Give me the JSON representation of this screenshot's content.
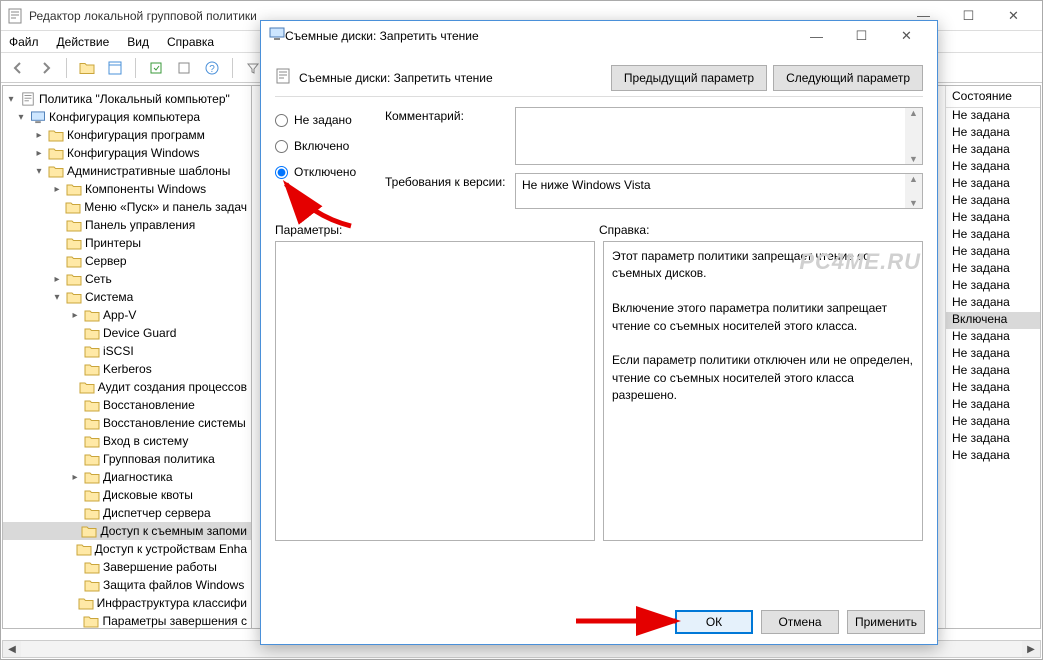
{
  "mainWindow": {
    "title": "Редактор локальной групповой политики",
    "menus": [
      "Файл",
      "Действие",
      "Вид",
      "Справка"
    ],
    "winButtons": {
      "min": "—",
      "max": "☐",
      "close": "✕"
    }
  },
  "tree": {
    "root": "Политика \"Локальный компьютер\"",
    "items": [
      {
        "indent": 0,
        "twist": "▾",
        "icon": "computer",
        "label": "Конфигурация компьютера"
      },
      {
        "indent": 1,
        "twist": "▸",
        "icon": "folder",
        "label": "Конфигурация программ"
      },
      {
        "indent": 1,
        "twist": "▸",
        "icon": "folder",
        "label": "Конфигурация Windows"
      },
      {
        "indent": 1,
        "twist": "▾",
        "icon": "folder",
        "label": "Административные шаблоны"
      },
      {
        "indent": 2,
        "twist": "▸",
        "icon": "folder",
        "label": "Компоненты Windows"
      },
      {
        "indent": 2,
        "twist": "",
        "icon": "folder",
        "label": "Меню «Пуск» и панель задач"
      },
      {
        "indent": 2,
        "twist": "",
        "icon": "folder",
        "label": "Панель управления"
      },
      {
        "indent": 2,
        "twist": "",
        "icon": "folder",
        "label": "Принтеры"
      },
      {
        "indent": 2,
        "twist": "",
        "icon": "folder",
        "label": "Сервер"
      },
      {
        "indent": 2,
        "twist": "▸",
        "icon": "folder",
        "label": "Сеть"
      },
      {
        "indent": 2,
        "twist": "▾",
        "icon": "folder",
        "label": "Система"
      },
      {
        "indent": 3,
        "twist": "▸",
        "icon": "folder",
        "label": "App-V"
      },
      {
        "indent": 3,
        "twist": "",
        "icon": "folder",
        "label": "Device Guard"
      },
      {
        "indent": 3,
        "twist": "",
        "icon": "folder",
        "label": "iSCSI"
      },
      {
        "indent": 3,
        "twist": "",
        "icon": "folder",
        "label": "Kerberos"
      },
      {
        "indent": 3,
        "twist": "",
        "icon": "folder",
        "label": "Аудит создания процессов"
      },
      {
        "indent": 3,
        "twist": "",
        "icon": "folder",
        "label": "Восстановление"
      },
      {
        "indent": 3,
        "twist": "",
        "icon": "folder",
        "label": "Восстановление системы"
      },
      {
        "indent": 3,
        "twist": "",
        "icon": "folder",
        "label": "Вход в систему"
      },
      {
        "indent": 3,
        "twist": "",
        "icon": "folder",
        "label": "Групповая политика"
      },
      {
        "indent": 3,
        "twist": "▸",
        "icon": "folder",
        "label": "Диагностика"
      },
      {
        "indent": 3,
        "twist": "",
        "icon": "folder",
        "label": "Дисковые квоты"
      },
      {
        "indent": 3,
        "twist": "",
        "icon": "folder",
        "label": "Диспетчер сервера"
      },
      {
        "indent": 3,
        "twist": "",
        "icon": "folder",
        "label": "Доступ к съемным запоми",
        "selected": true
      },
      {
        "indent": 3,
        "twist": "",
        "icon": "folder",
        "label": "Доступ к устройствам Enha"
      },
      {
        "indent": 3,
        "twist": "",
        "icon": "folder",
        "label": "Завершение работы"
      },
      {
        "indent": 3,
        "twist": "",
        "icon": "folder",
        "label": "Защита файлов Windows"
      },
      {
        "indent": 3,
        "twist": "",
        "icon": "folder",
        "label": "Инфраструктура классифи"
      },
      {
        "indent": 3,
        "twist": "",
        "icon": "folder",
        "label": "Параметры завершения с"
      }
    ]
  },
  "stateColumn": {
    "header": "Состояние",
    "rows": [
      "Не задана",
      "Не задана",
      "Не задана",
      "Не задана",
      "Не задана",
      "Не задана",
      "Не задана",
      "Не задана",
      "Не задана",
      "Не задана",
      "Не задана",
      "Не задана",
      {
        "text": "Включена",
        "selected": true
      },
      "Не задана",
      "Не задана",
      "Не задана",
      "Не задана",
      "Не задана",
      "Не задана",
      "Не задана",
      "Не задана"
    ]
  },
  "dialog": {
    "title": "Съемные диски: Запретить чтение",
    "headerLabel": "Съемные диски: Запретить чтение",
    "prevBtn": "Предыдущий параметр",
    "nextBtn": "Следующий параметр",
    "radios": {
      "notset": "Не задано",
      "enabled": "Включено",
      "disabled": "Отключено"
    },
    "selectedRadio": "disabled",
    "commentLabel": "Комментарий:",
    "commentValue": "",
    "reqLabel": "Требования к версии:",
    "reqValue": "Не ниже Windows Vista",
    "paramsLabel": "Параметры:",
    "helpLabel": "Справка:",
    "helpText": "Этот параметр политики запрещает чтение со съемных дисков.\n\nВключение этого параметра политики запрещает чтение со съемных носителей этого класса.\n\nЕсли параметр политики отключен или не определен, чтение со съемных носителей этого класса разрешено.",
    "ok": "ОК",
    "cancel": "Отмена",
    "apply": "Применить",
    "winButtons": {
      "min": "—",
      "max": "☐",
      "close": "✕"
    }
  },
  "watermark": "PC4ME.RU"
}
